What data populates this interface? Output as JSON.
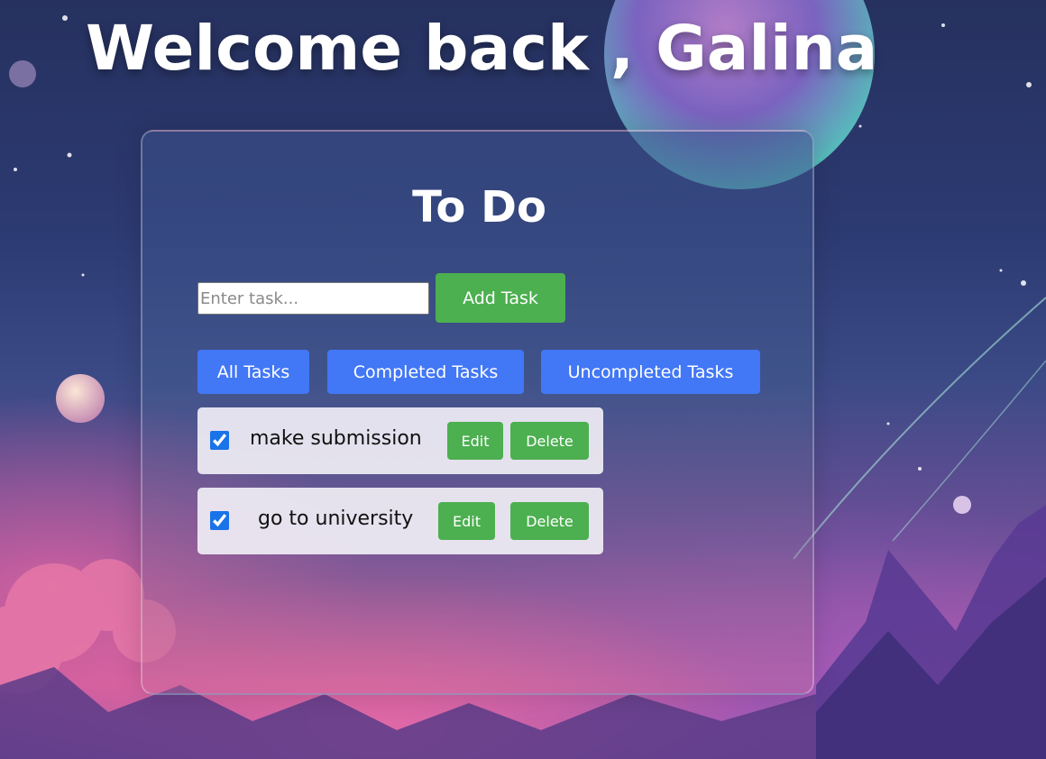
{
  "page": {
    "welcome": "Welcome back , Galina"
  },
  "todo": {
    "title": "To Do",
    "input": {
      "value": "",
      "placeholder": "Enter task..."
    },
    "add_label": "Add Task",
    "filters": {
      "all": "All Tasks",
      "completed": "Completed Tasks",
      "uncompleted": "Uncompleted Tasks"
    },
    "tasks": [
      {
        "text": "make submission",
        "completed": true,
        "edit_label": "Edit",
        "delete_label": "Delete"
      },
      {
        "text": "go to university",
        "completed": true,
        "edit_label": "Edit",
        "delete_label": "Delete"
      }
    ]
  },
  "colors": {
    "primary_green": "#4caf50",
    "filter_blue": "#4277f5",
    "card_border": "rgba(255,255,255,0.28)",
    "task_bg": "#f0eef5"
  }
}
